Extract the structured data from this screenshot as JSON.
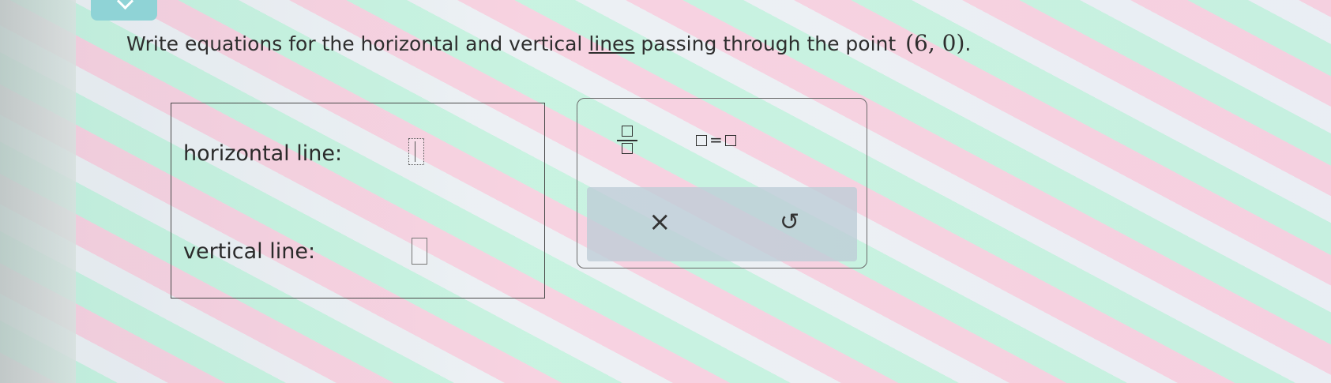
{
  "question": {
    "before_link": "Write equations for the horizontal and vertical ",
    "link": "lines",
    "after_link": " passing through the point ",
    "point": "(6, 0)",
    "period": "."
  },
  "answer": {
    "horizontal_label": "horizontal line:",
    "vertical_label": "vertical line:"
  },
  "palette": {
    "equals_sign": "=",
    "clear_symbol": "×",
    "undo_symbol": "↺"
  }
}
